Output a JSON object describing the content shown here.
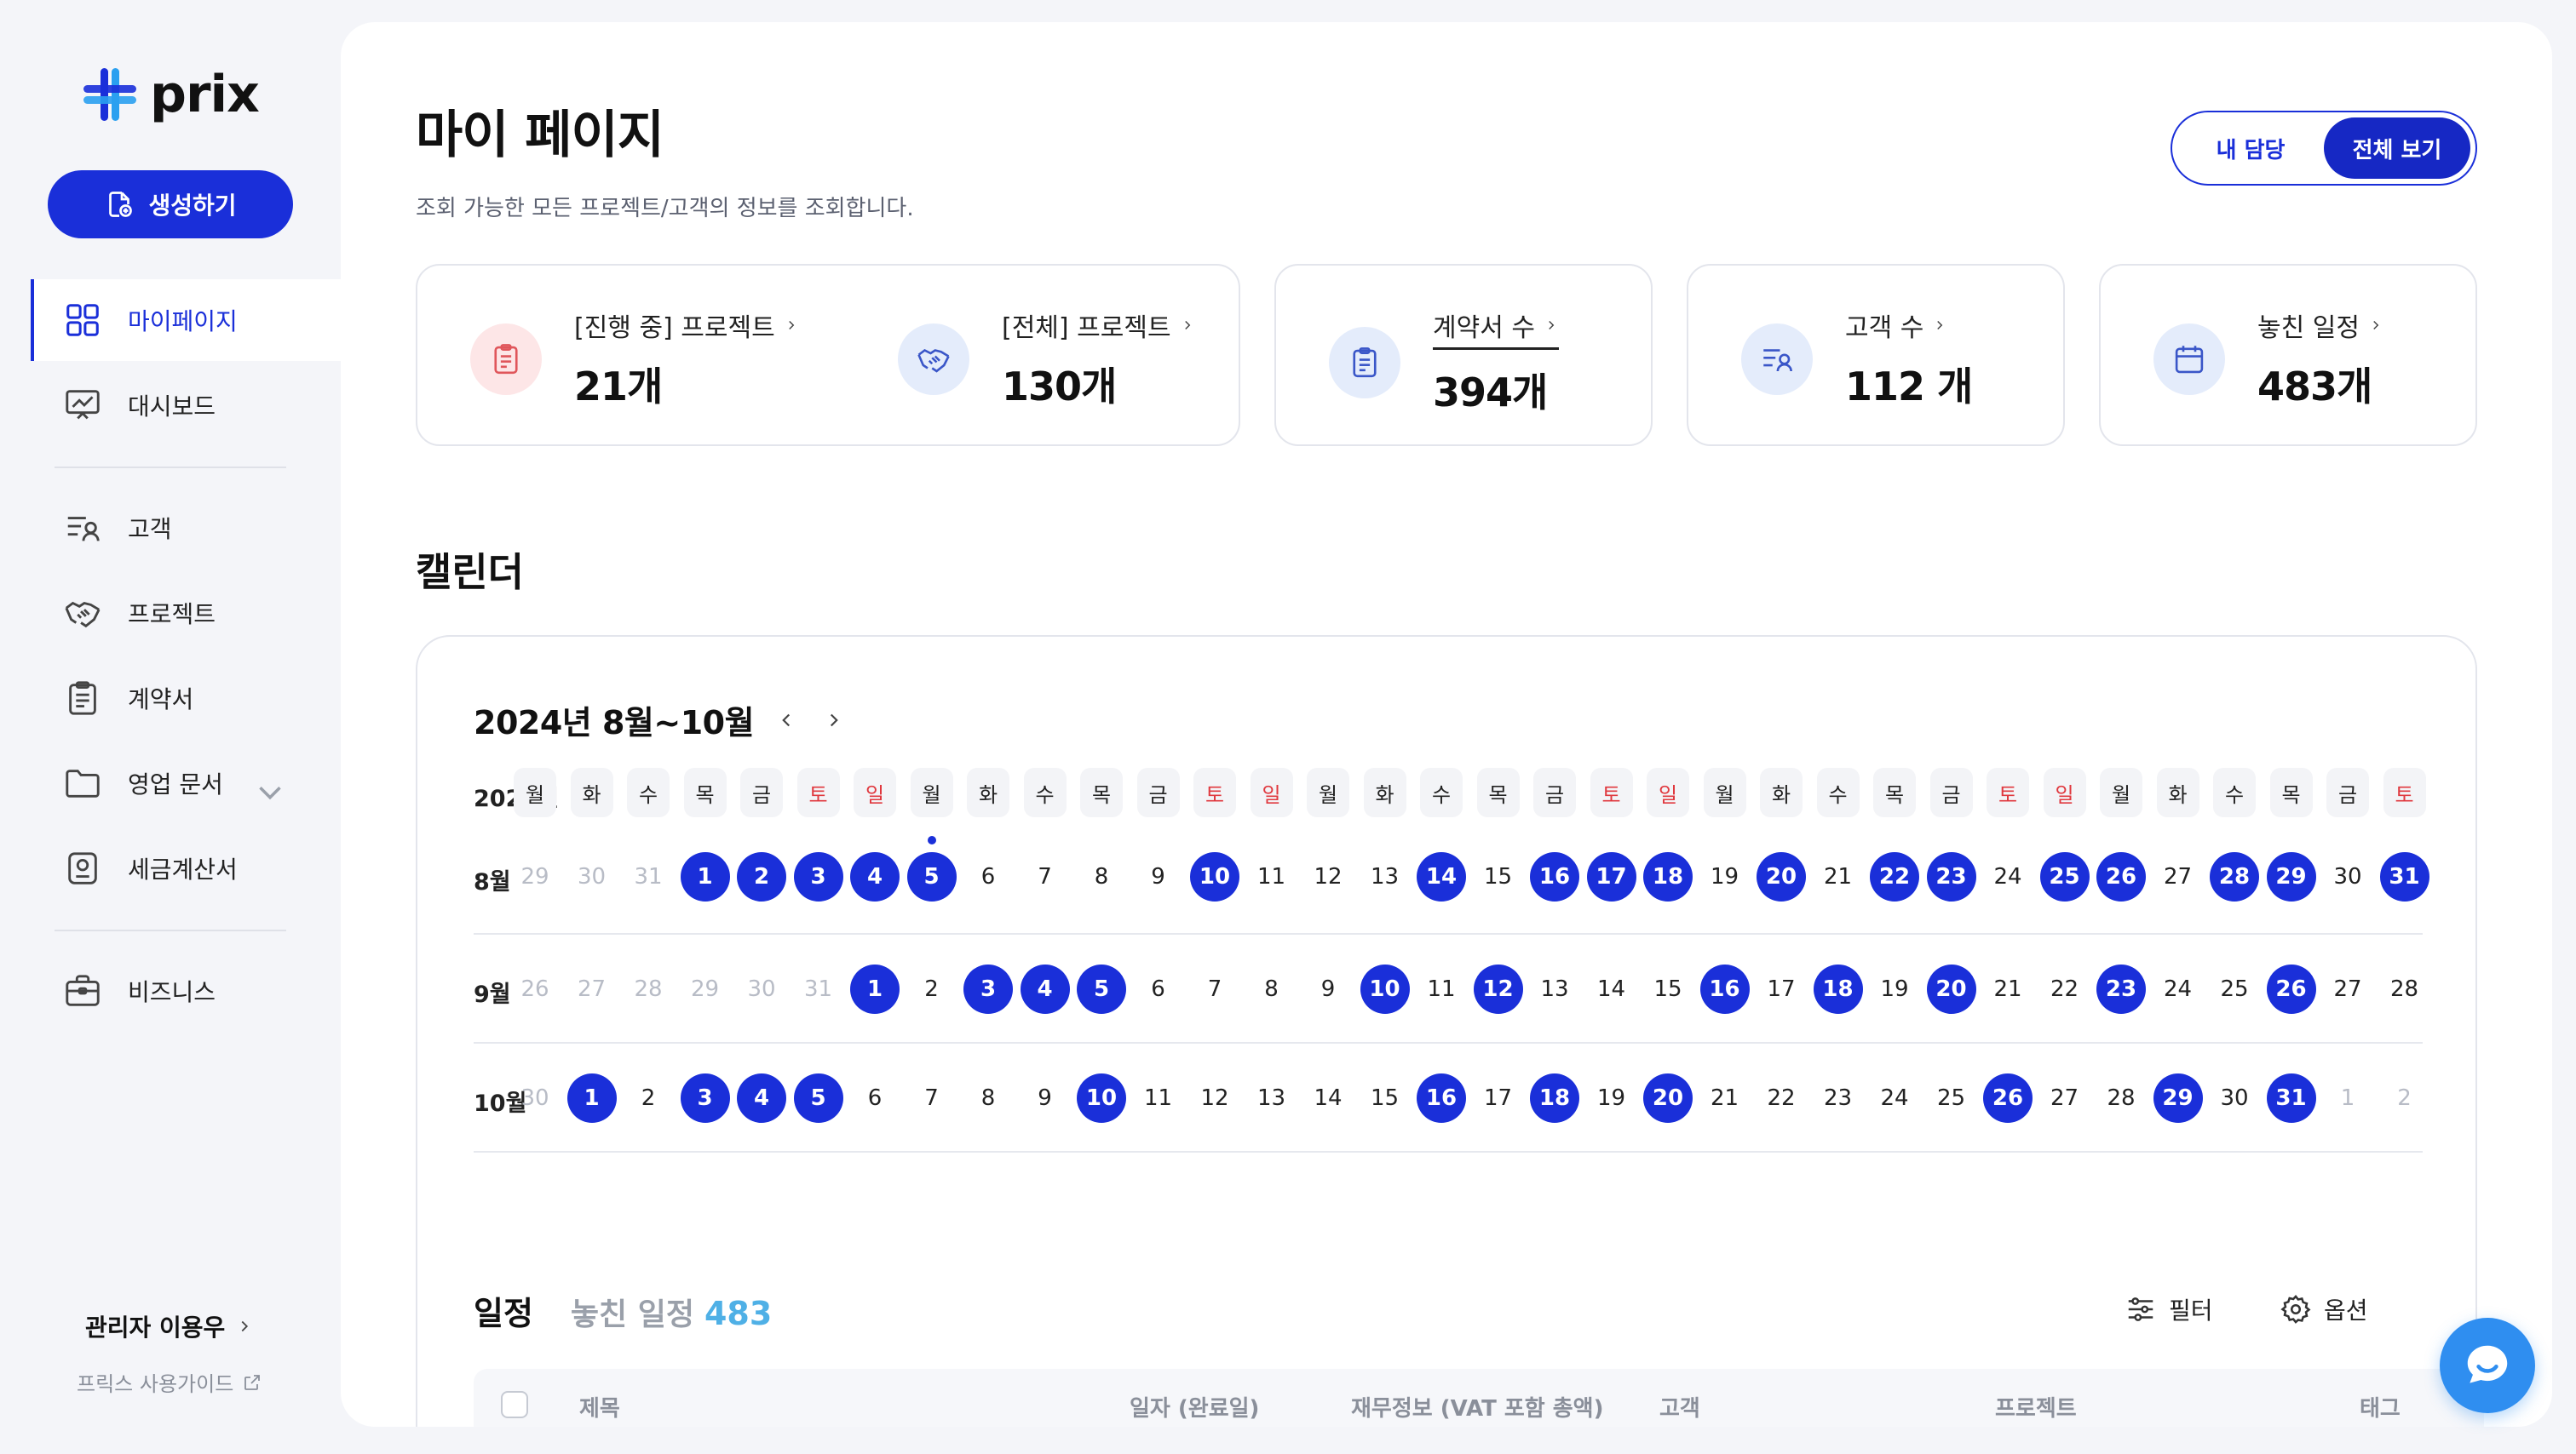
{
  "brand": {
    "name": "prix"
  },
  "sidebar": {
    "create_label": "생성하기",
    "items": [
      {
        "label": "마이페이지",
        "icon": "grid-icon",
        "active": true
      },
      {
        "label": "대시보드",
        "icon": "dashboard-icon"
      },
      {
        "label": "고객",
        "icon": "customer-icon"
      },
      {
        "label": "프로젝트",
        "icon": "handshake-icon"
      },
      {
        "label": "계약서",
        "icon": "clipboard-icon"
      },
      {
        "label": "영업 문서",
        "icon": "folder-icon"
      },
      {
        "label": "세금계산서",
        "icon": "receipt-icon"
      },
      {
        "label": "비즈니스",
        "icon": "briefcase-icon"
      }
    ],
    "admin_label": "관리자 이용우",
    "guide_label": "프릭스 사용가이드"
  },
  "header": {
    "title": "마이 페이지",
    "subtitle": "조회 가능한 모든 프로젝트/고객의 정보를 조회합니다.",
    "toggle": [
      "내 담당",
      "전체 보기"
    ],
    "toggle_selected": "전체 보기"
  },
  "stats": [
    {
      "label": "[진행 중] 프로젝트",
      "value": "21개"
    },
    {
      "label": "[전체] 프로젝트",
      "value": "130개"
    },
    {
      "label": "계약서 수",
      "value": "394개"
    },
    {
      "label": "고객 수",
      "value": "112 개"
    },
    {
      "label": "놓친 일정",
      "value": "483개"
    }
  ],
  "calendar": {
    "section_title": "캘린더",
    "range_title": "2024년 8월~10월",
    "year_label": "2024년",
    "weekdays": [
      "월",
      "화",
      "수",
      "목",
      "금",
      "토",
      "일",
      "월",
      "화",
      "수",
      "목",
      "금",
      "토",
      "일",
      "월",
      "화",
      "수",
      "목",
      "금",
      "토",
      "일",
      "월",
      "화",
      "수",
      "목",
      "금",
      "토",
      "일",
      "월",
      "화",
      "수",
      "목",
      "금",
      "토"
    ],
    "weekend_color": "#e0383e",
    "accent": "#1a2fd9",
    "months": [
      {
        "label": "8월",
        "days": [
          "29",
          "30",
          "31",
          "1",
          "2",
          "3",
          "4",
          "5",
          "6",
          "7",
          "8",
          "9",
          "10",
          "11",
          "12",
          "13",
          "14",
          "15",
          "16",
          "17",
          "18",
          "19",
          "20",
          "21",
          "22",
          "23",
          "24",
          "25",
          "26",
          "27",
          "28",
          "29",
          "30",
          "31"
        ],
        "outside": [
          0,
          1,
          2
        ],
        "marked": [
          3,
          4,
          5,
          6,
          7,
          12,
          16,
          18,
          19,
          20,
          22,
          24,
          25,
          27,
          28,
          30,
          31,
          33
        ],
        "today": 7
      },
      {
        "label": "9월",
        "days": [
          "26",
          "27",
          "28",
          "29",
          "30",
          "31",
          "1",
          "2",
          "3",
          "4",
          "5",
          "6",
          "7",
          "8",
          "9",
          "10",
          "11",
          "12",
          "13",
          "14",
          "15",
          "16",
          "17",
          "18",
          "19",
          "20",
          "21",
          "22",
          "23",
          "24",
          "25",
          "26",
          "27",
          "28"
        ],
        "outside": [
          0,
          1,
          2,
          3,
          4,
          5
        ],
        "marked": [
          6,
          8,
          9,
          10,
          15,
          17,
          21,
          23,
          25,
          28,
          31
        ]
      },
      {
        "label": "10월",
        "days": [
          "30",
          "1",
          "2",
          "3",
          "4",
          "5",
          "6",
          "7",
          "8",
          "9",
          "10",
          "11",
          "12",
          "13",
          "14",
          "15",
          "16",
          "17",
          "18",
          "19",
          "20",
          "21",
          "22",
          "23",
          "24",
          "25",
          "26",
          "27",
          "28",
          "29",
          "30",
          "31",
          "1",
          "2"
        ],
        "outside": [
          0,
          32,
          33
        ],
        "marked": [
          1,
          3,
          4,
          5,
          10,
          16,
          18,
          20,
          26,
          29,
          31
        ]
      }
    ]
  },
  "schedule": {
    "title": "일정",
    "missed_label": "놓친 일정",
    "missed_count": "483",
    "filter_label": "필터",
    "options_label": "옵션",
    "columns": [
      "제목",
      "일자 (완료일)",
      "재무정보 (VAT 포함 총액)",
      "고객",
      "프로젝트",
      "태그"
    ]
  }
}
